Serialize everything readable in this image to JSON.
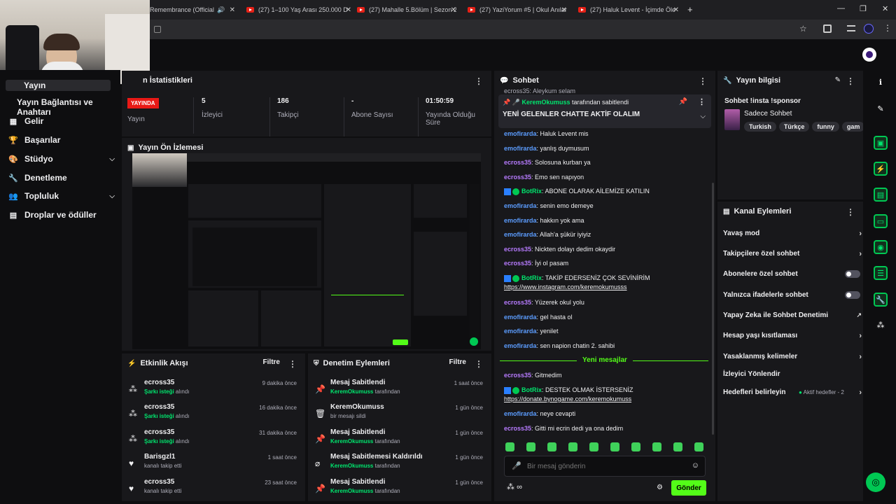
{
  "browser": {
    "tabs": [
      {
        "title": "Remembrance (Official"
      },
      {
        "title": "(27) 1–100 Yaş Arası 250.000 D"
      },
      {
        "title": "(27) Mahalle 5.Bölüm | Sezon 2"
      },
      {
        "title": "(27) YaziYorum #5 | Okul Anılar"
      },
      {
        "title": "(27) Haluk Levent - İçimde Öle"
      }
    ]
  },
  "sidebar": {
    "items": [
      {
        "label": "Yayın"
      },
      {
        "label": "Yayın Bağlantısı ve Anahtarı"
      },
      {
        "label": "Gelir"
      },
      {
        "label": "Başarılar"
      },
      {
        "label": "Stüdyo"
      },
      {
        "label": "Denetleme"
      },
      {
        "label": "Topluluk"
      },
      {
        "label": "Droplar ve ödüller"
      }
    ]
  },
  "stats": {
    "title": "n İstatistikleri",
    "live_badge": "YAYINDA",
    "live_label": "Yayın",
    "items": [
      {
        "value": "5",
        "label": "İzleyici"
      },
      {
        "value": "186",
        "label": "Takipçi"
      },
      {
        "value": "-",
        "label": "Abone Sayısı"
      },
      {
        "value": "01:50:59",
        "label": "Yayında Olduğu Süre"
      }
    ]
  },
  "preview": {
    "title": "Yayın Ön İzlemesi"
  },
  "activity": {
    "title": "Etkinlik Akışı",
    "filter": "Filtre",
    "items": [
      {
        "name": "ecross35",
        "action": "Şarkı isteği",
        "suffix": "alındı",
        "time": "9 dakika önce"
      },
      {
        "name": "ecross35",
        "action": "Şarkı isteği",
        "suffix": "alındı",
        "time": "16 dakika önce"
      },
      {
        "name": "ecross35",
        "action": "Şarkı isteği",
        "suffix": "alındı",
        "time": "31 dakika önce"
      },
      {
        "name": "Barisgzl1",
        "action": "",
        "suffix": "kanalı takip etti",
        "time": "1 saat önce"
      },
      {
        "name": "ecross35",
        "action": "",
        "suffix": "kanalı takip etti",
        "time": "23 saat önce"
      }
    ]
  },
  "moderation": {
    "title": "Denetim Eylemleri",
    "filter": "Filtre",
    "items": [
      {
        "name": "Mesaj Sabitlendi",
        "actor": "KeremOkumuss",
        "suffix": "tarafından",
        "time": "1 saat önce"
      },
      {
        "name": "KeremOkumuss",
        "actor": "",
        "suffix": "bir mesajı sildi",
        "time": "1 gün önce"
      },
      {
        "name": "Mesaj Sabitlendi",
        "actor": "KeremOkumuss",
        "suffix": "tarafından",
        "time": "1 gün önce"
      },
      {
        "name": "Mesaj Sabitlemesi Kaldırıldı",
        "actor": "KeremOkumuss",
        "suffix": "tarafından",
        "time": "1 gün önce"
      },
      {
        "name": "Mesaj Sabitlendi",
        "actor": "KeremOkumuss",
        "suffix": "tarafından",
        "time": "1 gün önce"
      }
    ]
  },
  "chat": {
    "title": "Sohbet",
    "partial_top": "ecross35: Aleykum selam",
    "pinned_by": "KeremOkumuss",
    "pinned_by_suffix": "tarafından sabitlendi",
    "pinned_text": "YENİ GELENLER CHATTE AKTİF OLALIM",
    "messages": [
      {
        "user": "emofirarda",
        "text": ": Haluk Levent mis"
      },
      {
        "user": "emofirarda",
        "text": ": yanlış duymusum"
      },
      {
        "user": "ecross35",
        "text": ": Solosuna kurban ya"
      },
      {
        "user": "ecross35",
        "text": ": Emo sen napıyon"
      },
      {
        "user": "BotRix",
        "text": ": ABONE OLARAK AİLEMİZE KATILIN"
      },
      {
        "user": "emofirarda",
        "text": ": senin emo demeye"
      },
      {
        "user": "emofirarda",
        "text": ": hakkın yok ama"
      },
      {
        "user": "emofirarda",
        "text": ": Allah'a şükür iyiyiz"
      },
      {
        "user": "ecross35",
        "text": ": Nickten dolayı dedim okaydir"
      },
      {
        "user": "ecross35",
        "text": ": İyi ol pasam"
      },
      {
        "user": "BotRix",
        "text": ": TAKİP EDERSENİZ ÇOK SEVİNİRİM",
        "link": "https://www.instagram.com/keremokumusss"
      },
      {
        "user": "ecross35",
        "text": ": Yüzerek okul yolu"
      },
      {
        "user": "emofirarda",
        "text": ": gel hasta ol"
      },
      {
        "user": "emofirarda",
        "text": ": yenilet"
      },
      {
        "user": "emofirarda",
        "text": ": sen napion chatin 2. sahibi"
      }
    ],
    "new_messages": "Yeni mesajlar",
    "after": [
      {
        "user": "ecross35",
        "text": ": Gitmedim"
      },
      {
        "user": "BotRix",
        "text": ": DESTEK OLMAK İSTERSENİZ",
        "link": "https://donate.bynogame.com/keremokumuss"
      },
      {
        "user": "emofirarda",
        "text": ": neye cevapti"
      },
      {
        "user": "ecross35",
        "text": ": Gitti mi ecrin dedi ya ona dedim"
      }
    ],
    "input_placeholder": "Bir mesaj gönderin",
    "send": "Gönder",
    "points": "∞"
  },
  "stream_info": {
    "title": "Yayın bilgisi",
    "stream_title": "Sohbet !insta !sponsor",
    "category": "Sadece Sohbet",
    "tags": [
      "Turkish",
      "Türkçe",
      "funny",
      "gam"
    ]
  },
  "channel_actions": {
    "title": "Kanal Eylemleri",
    "rows": [
      {
        "label": "Yavaş mod",
        "control": "chevron"
      },
      {
        "label": "Takipçilere özel sohbet",
        "control": "chevron"
      },
      {
        "label": "Abonelere özel sohbet",
        "control": "toggle"
      },
      {
        "label": "Yalnızca ifadelerle sohbet",
        "control": "toggle"
      },
      {
        "label": "Yapay Zeka ile Sohbet Denetimi",
        "control": "external"
      },
      {
        "label": "Hesap yaşı kısıtlaması",
        "control": "chevron"
      },
      {
        "label": "Yasaklanmış kelimeler",
        "control": "chevron"
      },
      {
        "label": "İzleyici Yönlendir",
        "control": "none"
      },
      {
        "label": "Hedefleri belirleyin",
        "control": "chevron",
        "status": "Aktif hedefler - 2"
      }
    ]
  },
  "colors": {
    "accent": "#53fc18",
    "live": "#e91916",
    "panel": "#18181b"
  }
}
